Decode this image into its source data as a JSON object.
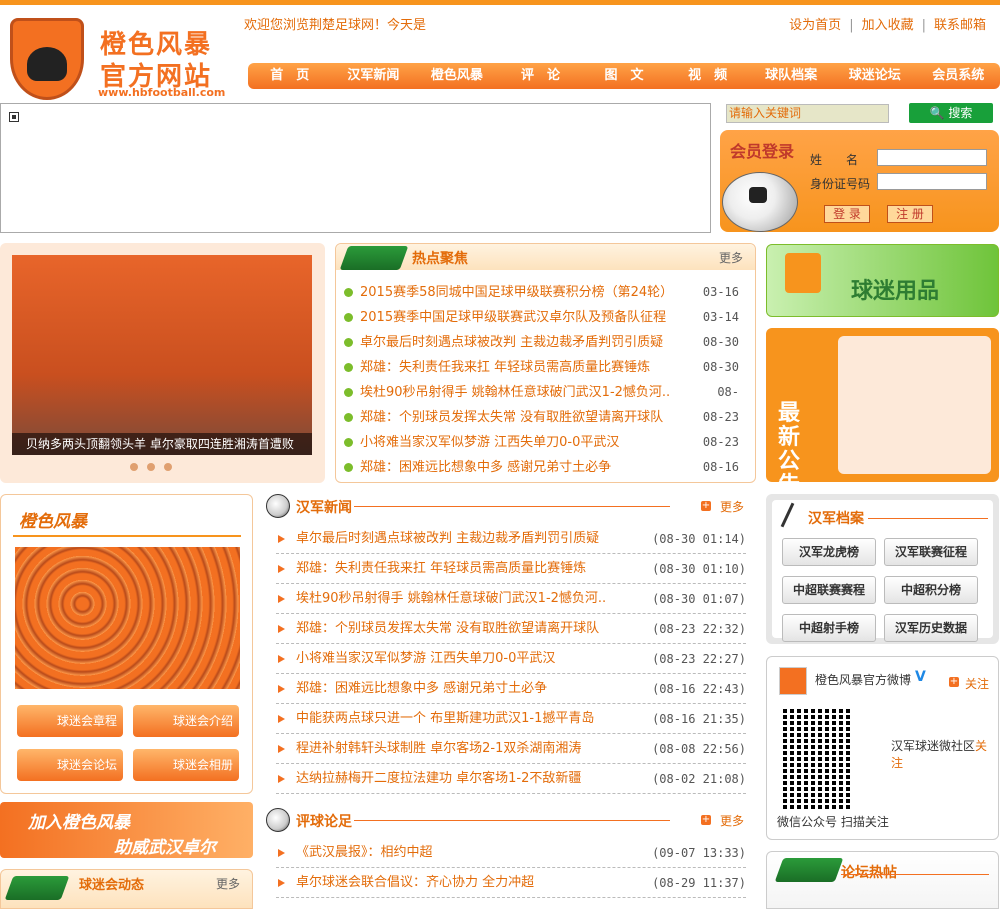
{
  "header": {
    "logo_line1": "橙色风暴",
    "logo_line2": "官方网站",
    "logo_url": "www.hbfootball.com",
    "welcome": "欢迎您浏览荆楚足球网！今天是",
    "links": [
      "设为首页",
      "加入收藏",
      "联系邮箱"
    ]
  },
  "nav": [
    "首　页",
    "汉军新闻",
    "橙色风暴",
    "评　论",
    "图　文",
    "视　频",
    "球队档案",
    "球迷论坛",
    "会员系统"
  ],
  "search": {
    "placeholder": "请输入关键词",
    "button": "搜索"
  },
  "login": {
    "title": "会员登录",
    "name_label": "姓　　名",
    "id_label": "身份证号码",
    "login_btn": "登 录",
    "register_btn": "注 册"
  },
  "slider": {
    "caption": "贝纳多两头顶翻领头羊 卓尔豪取四连胜湘涛首遭败"
  },
  "hot": {
    "title": "热点聚焦",
    "more": "更多",
    "items": [
      {
        "text": "2015赛季58同城中国足球甲级联赛积分榜（第24轮）",
        "date": "03-16"
      },
      {
        "text": "2015赛季中国足球甲级联赛武汉卓尔队及预备队征程",
        "date": "03-14"
      },
      {
        "text": "卓尔最后时刻遇点球被改判 主裁边裁矛盾判罚引质疑",
        "date": "08-30"
      },
      {
        "text": "郑雄：失利责任我来扛 年轻球员需高质量比赛锤炼",
        "date": "08-30"
      },
      {
        "text": "埃杜90秒吊射得手 姚翰林任意球破门武汉1-2憾负河..",
        "date": "08-"
      },
      {
        "text": "郑雄：个别球员发挥太失常 没有取胜欲望请离开球队",
        "date": "08-23"
      },
      {
        "text": "小将难当家汉军似梦游 江西失单刀0-0平武汉",
        "date": "08-23"
      },
      {
        "text": "郑雄：困难远比想象中多 感谢兄弟寸土必争",
        "date": "08-16"
      }
    ]
  },
  "goods": {
    "title": "球迷用品"
  },
  "notice": {
    "title": "最新公告"
  },
  "storm": {
    "title": "橙色风暴",
    "buttons": [
      "球迷会章程",
      "球迷会介绍",
      "球迷会论坛",
      "球迷会相册"
    ]
  },
  "join": {
    "line1": "加入橙色风暴",
    "line2": "助威武汉卓尔"
  },
  "fans": {
    "title": "球迷会动态",
    "more": "更多"
  },
  "news": {
    "title": "汉军新闻",
    "more": "更多",
    "items": [
      {
        "text": "卓尔最后时刻遇点球被改判 主裁边裁矛盾判罚引质疑",
        "date": "(08-30 01:14)"
      },
      {
        "text": "郑雄：失利责任我来扛 年轻球员需高质量比赛锤炼",
        "date": "(08-30 01:10)"
      },
      {
        "text": "埃杜90秒吊射得手 姚翰林任意球破门武汉1-2憾负河..",
        "date": "(08-30 01:07)"
      },
      {
        "text": "郑雄：个别球员发挥太失常 没有取胜欲望请离开球队",
        "date": "(08-23 22:32)"
      },
      {
        "text": "小将难当家汉军似梦游 江西失单刀0-0平武汉",
        "date": "(08-23 22:27)"
      },
      {
        "text": "郑雄：困难远比想象中多 感谢兄弟寸土必争",
        "date": "(08-16 22:43)"
      },
      {
        "text": "中能获两点球只进一个 布里斯建功武汉1-1撼平青岛",
        "date": "(08-16 21:35)"
      },
      {
        "text": "程进补射韩轩头球制胜 卓尔客场2-1双杀湖南湘涛",
        "date": "(08-08 22:56)"
      },
      {
        "text": "达纳拉赫梅开二度拉法建功 卓尔客场1-2不敌新疆",
        "date": "(08-02 21:08)"
      }
    ]
  },
  "comment": {
    "title": "评球论足",
    "more": "更多",
    "items": [
      {
        "text": "《武汉晨报》：相约中超",
        "date": "(09-07 13:33)"
      },
      {
        "text": "卓尔球迷会联合倡议：齐心协力 全力冲超",
        "date": "(08-29 11:37)"
      }
    ]
  },
  "archive": {
    "title": "汉军档案",
    "buttons": [
      "汉军龙虎榜",
      "汉军联赛征程",
      "中超联赛赛程",
      "中超积分榜",
      "中超射手榜",
      "汉军历史数据"
    ]
  },
  "weibo": {
    "name": "橙色风暴官方微博",
    "verified": "V",
    "follow": "关注",
    "sub_text": "汉军球迷微社区",
    "sub_follow": "关注",
    "wechat": "微信公众号 扫描关注"
  },
  "forum": {
    "title": "论坛热帖"
  }
}
